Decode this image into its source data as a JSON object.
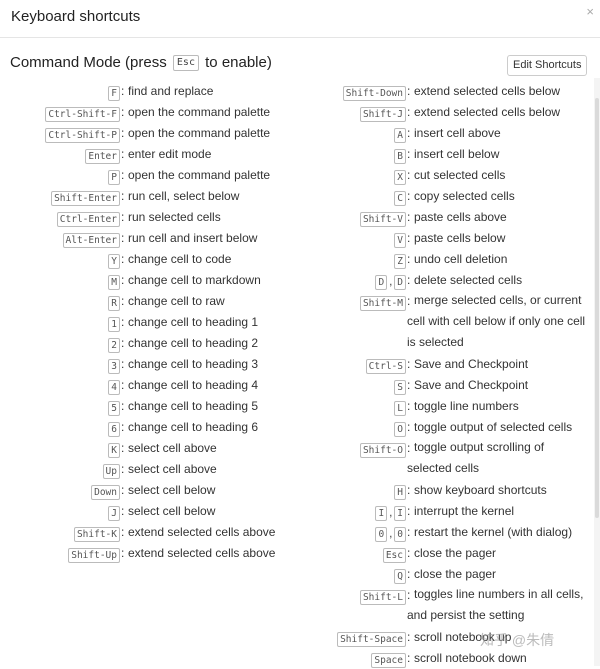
{
  "dialog": {
    "title": "Keyboard shortcuts",
    "close_symbol": "×"
  },
  "mode": {
    "title_prefix": "Command Mode (press",
    "title_key": "Esc",
    "title_suffix": "to enable)",
    "edit_button": "Edit Shortcuts"
  },
  "watermark": "知乎 @朱倩",
  "left_shortcuts": [
    {
      "keys": [
        "F"
      ],
      "desc": "find and replace"
    },
    {
      "keys": [
        "Ctrl-Shift-F"
      ],
      "desc": "open the command palette"
    },
    {
      "keys": [
        "Ctrl-Shift-P"
      ],
      "desc": "open the command palette"
    },
    {
      "keys": [
        "Enter"
      ],
      "desc": "enter edit mode"
    },
    {
      "keys": [
        "P"
      ],
      "desc": "open the command palette"
    },
    {
      "keys": [
        "Shift-Enter"
      ],
      "desc": "run cell, select below"
    },
    {
      "keys": [
        "Ctrl-Enter"
      ],
      "desc": "run selected cells"
    },
    {
      "keys": [
        "Alt-Enter"
      ],
      "desc": "run cell and insert below"
    },
    {
      "keys": [
        "Y"
      ],
      "desc": "change cell to code"
    },
    {
      "keys": [
        "M"
      ],
      "desc": "change cell to markdown"
    },
    {
      "keys": [
        "R"
      ],
      "desc": "change cell to raw"
    },
    {
      "keys": [
        "1"
      ],
      "desc": "change cell to heading 1"
    },
    {
      "keys": [
        "2"
      ],
      "desc": "change cell to heading 2"
    },
    {
      "keys": [
        "3"
      ],
      "desc": "change cell to heading 3"
    },
    {
      "keys": [
        "4"
      ],
      "desc": "change cell to heading 4"
    },
    {
      "keys": [
        "5"
      ],
      "desc": "change cell to heading 5"
    },
    {
      "keys": [
        "6"
      ],
      "desc": "change cell to heading 6"
    },
    {
      "keys": [
        "K"
      ],
      "desc": "select cell above"
    },
    {
      "keys": [
        "Up"
      ],
      "desc": "select cell above"
    },
    {
      "keys": [
        "Down"
      ],
      "desc": "select cell below"
    },
    {
      "keys": [
        "J"
      ],
      "desc": "select cell below"
    },
    {
      "keys": [
        "Shift-K"
      ],
      "desc": "extend selected cells above"
    },
    {
      "keys": [
        "Shift-Up"
      ],
      "desc": "extend selected cells above"
    }
  ],
  "right_shortcuts": [
    {
      "keys": [
        "Shift-Down"
      ],
      "desc": "extend selected cells below"
    },
    {
      "keys": [
        "Shift-J"
      ],
      "desc": "extend selected cells below"
    },
    {
      "keys": [
        "A"
      ],
      "desc": "insert cell above"
    },
    {
      "keys": [
        "B"
      ],
      "desc": "insert cell below"
    },
    {
      "keys": [
        "X"
      ],
      "desc": "cut selected cells"
    },
    {
      "keys": [
        "C"
      ],
      "desc": "copy selected cells"
    },
    {
      "keys": [
        "Shift-V"
      ],
      "desc": "paste cells above"
    },
    {
      "keys": [
        "V"
      ],
      "desc": "paste cells below"
    },
    {
      "keys": [
        "Z"
      ],
      "desc": "undo cell deletion"
    },
    {
      "keys": [
        "D",
        "D"
      ],
      "desc": "delete selected cells"
    },
    {
      "keys": [
        "Shift-M"
      ],
      "desc": "merge selected cells, or current cell with cell below if only one cell is selected",
      "lines": 3
    },
    {
      "keys": [
        "Ctrl-S"
      ],
      "desc": "Save and Checkpoint"
    },
    {
      "keys": [
        "S"
      ],
      "desc": "Save and Checkpoint"
    },
    {
      "keys": [
        "L"
      ],
      "desc": "toggle line numbers"
    },
    {
      "keys": [
        "O"
      ],
      "desc": "toggle output of selected cells"
    },
    {
      "keys": [
        "Shift-O"
      ],
      "desc": "toggle output scrolling of selected cells",
      "lines": 2
    },
    {
      "keys": [
        "H"
      ],
      "desc": "show keyboard shortcuts"
    },
    {
      "keys": [
        "I",
        "I"
      ],
      "desc": "interrupt the kernel"
    },
    {
      "keys": [
        "0",
        "0"
      ],
      "desc": "restart the kernel (with dialog)"
    },
    {
      "keys": [
        "Esc"
      ],
      "desc": "close the pager"
    },
    {
      "keys": [
        "Q"
      ],
      "desc": "close the pager"
    },
    {
      "keys": [
        "Shift-L"
      ],
      "desc": "toggles line numbers in all cells, and persist the setting",
      "lines": 2
    },
    {
      "keys": [
        "Shift-Space"
      ],
      "desc": "scroll notebook up"
    },
    {
      "keys": [
        "Space"
      ],
      "desc": "scroll notebook down"
    }
  ]
}
